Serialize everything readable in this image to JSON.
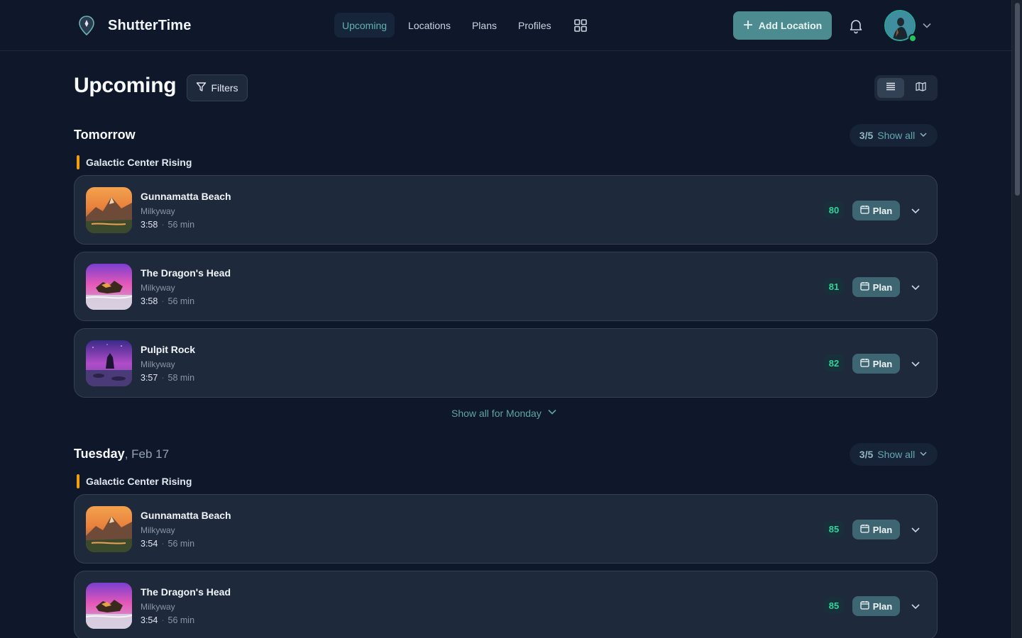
{
  "app": {
    "name": "ShutterTime"
  },
  "nav": {
    "items": [
      {
        "label": "Upcoming",
        "active": true
      },
      {
        "label": "Locations"
      },
      {
        "label": "Plans"
      },
      {
        "label": "Profiles"
      }
    ]
  },
  "header": {
    "add_location_label": "Add Location"
  },
  "page": {
    "title": "Upcoming",
    "filters_label": "Filters"
  },
  "colors": {
    "accent": "#4c8b8f",
    "event_bar": "#f59e0b",
    "score": "#34d399",
    "background": "#0f172a",
    "card": "#1e293b"
  },
  "sections": [
    {
      "day": "Tomorrow",
      "date": "",
      "count": "3/5",
      "show_all_label": "Show all",
      "event": "Galactic Center Rising",
      "cards": [
        {
          "name": "Gunnamatta Beach",
          "type": "Milkyway",
          "time": "3:58",
          "duration": "56 min",
          "score": "80",
          "plan_label": "Plan",
          "thumb": "sunset-mountain"
        },
        {
          "name": "The Dragon's Head",
          "type": "Milkyway",
          "time": "3:58",
          "duration": "56 min",
          "score": "81",
          "plan_label": "Plan",
          "thumb": "pink-rock-sea"
        },
        {
          "name": "Pulpit Rock",
          "type": "Milkyway",
          "time": "3:57",
          "duration": "58 min",
          "score": "82",
          "plan_label": "Plan",
          "thumb": "purple-rock-sea"
        }
      ],
      "show_more_label": "Show all for Monday"
    },
    {
      "day": "Tuesday",
      "date": ", Feb 17",
      "count": "3/5",
      "show_all_label": "Show all",
      "event": "Galactic Center Rising",
      "cards": [
        {
          "name": "Gunnamatta Beach",
          "type": "Milkyway",
          "time": "3:54",
          "duration": "56 min",
          "score": "85",
          "plan_label": "Plan",
          "thumb": "sunset-mountain"
        },
        {
          "name": "The Dragon's Head",
          "type": "Milkyway",
          "time": "3:54",
          "duration": "56 min",
          "score": "85",
          "plan_label": "Plan",
          "thumb": "pink-rock-sea"
        }
      ]
    }
  ]
}
